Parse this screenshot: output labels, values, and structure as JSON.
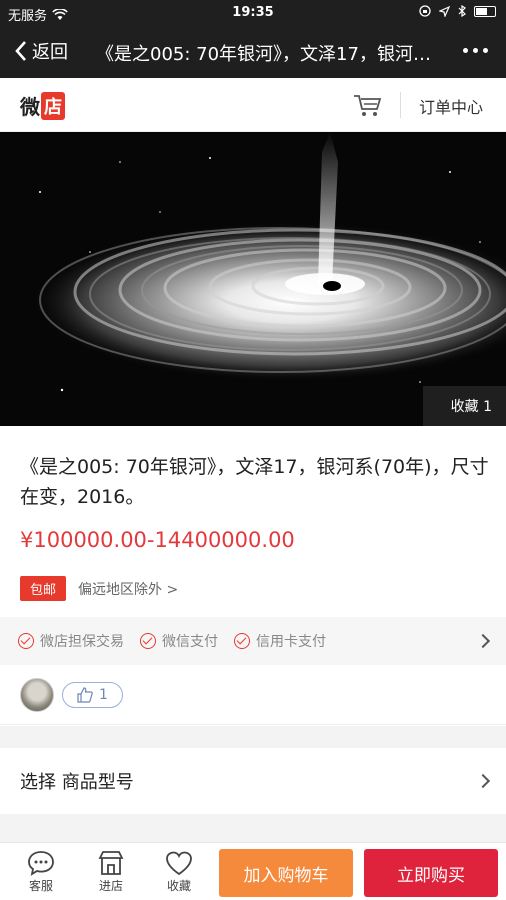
{
  "status_bar": {
    "carrier": "无服务",
    "time": "19:35"
  },
  "navbar": {
    "back_label": "返回",
    "title": "《是之005: 70年银河》，文泽17，银河系(70年)，尺寸在变，2016。"
  },
  "shop": {
    "logo_text": "微",
    "logo_badge": "店",
    "orders_label": "订单中心"
  },
  "hero": {
    "favorite_label": "收藏 1"
  },
  "product": {
    "title": "《是之005: 70年银河》，文泽17，银河系(70年)，尺寸在变，2016。",
    "price": "¥100000.00-14400000.00"
  },
  "shipping": {
    "tag": "包邮",
    "note": "偏远地区除外 >"
  },
  "guarantees": [
    "微店担保交易",
    "微信支付",
    "信用卡支付"
  ],
  "likes": {
    "count": "1"
  },
  "options": {
    "label": "选择 商品型号"
  },
  "bottom": {
    "chat": "客服",
    "store": "进店",
    "favorite": "收藏",
    "add_to_cart": "加入购物车",
    "buy_now": "立即购买"
  },
  "colors": {
    "accent": "#e8392d",
    "cart_button": "#f68a3c",
    "buy_button": "#e0233c",
    "nav_bg": "#1f1f1f"
  }
}
